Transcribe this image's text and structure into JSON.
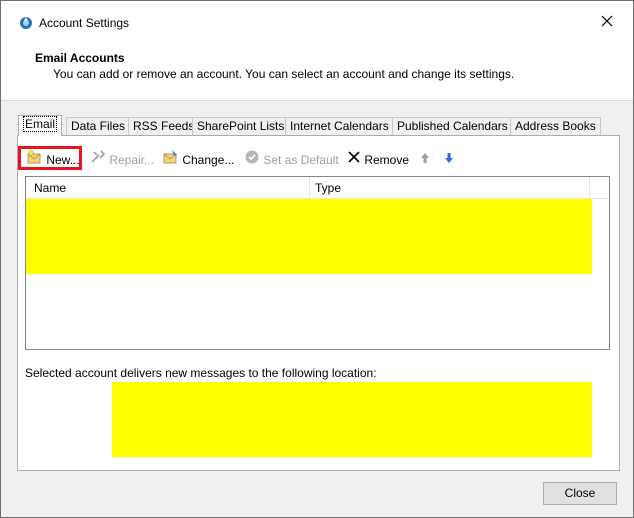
{
  "window": {
    "title": "Account Settings",
    "close_icon": "close-icon",
    "app_icon": "account-settings-icon"
  },
  "header": {
    "title": "Email Accounts",
    "description": "You can add or remove an account. You can select an account and change its settings."
  },
  "tabs": [
    {
      "label": "Email",
      "active": true
    },
    {
      "label": "Data Files"
    },
    {
      "label": "RSS Feeds"
    },
    {
      "label": "SharePoint Lists"
    },
    {
      "label": "Internet Calendars"
    },
    {
      "label": "Published Calendars"
    },
    {
      "label": "Address Books"
    }
  ],
  "toolbar": {
    "new_label": "New...",
    "repair_label": "Repair...",
    "change_label": "Change...",
    "set_default_label": "Set as Default",
    "remove_label": "Remove",
    "move_up_icon": "arrow-up-icon",
    "move_down_icon": "arrow-down-icon"
  },
  "accounts_list": {
    "columns": [
      "Name",
      "Type"
    ]
  },
  "delivery": {
    "label": "Selected account delivers new messages to the following location:"
  },
  "footer": {
    "close_label": "Close"
  },
  "colors": {
    "highlight_border": "#e8141b",
    "redaction": "#ffff00",
    "arrow_blue": "#2f6bd8"
  }
}
